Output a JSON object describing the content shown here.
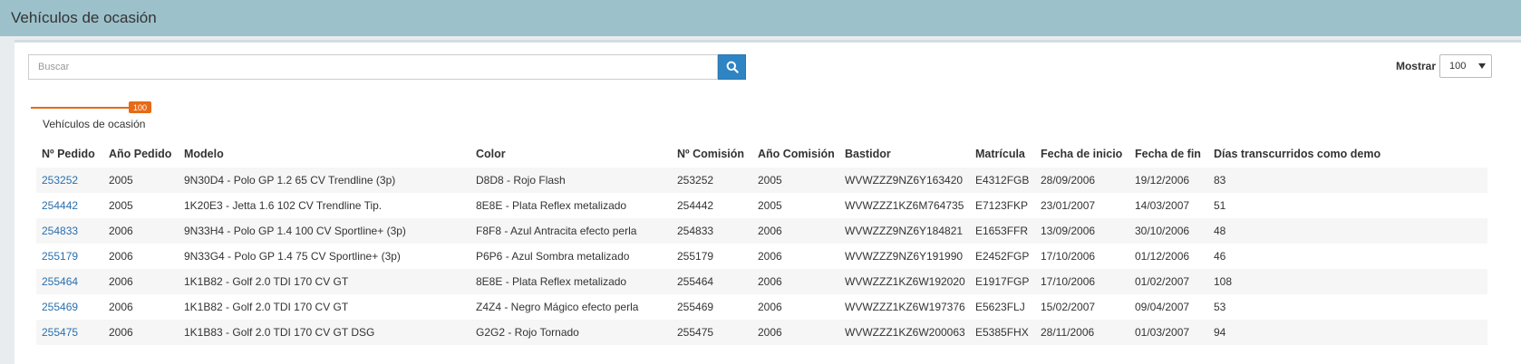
{
  "header": {
    "title": "Vehículos de ocasión"
  },
  "search": {
    "placeholder": "Buscar"
  },
  "show": {
    "label": "Mostrar",
    "value": "100"
  },
  "tab": {
    "label": "Vehículos de ocasión",
    "count": "100"
  },
  "table": {
    "columns": [
      "Nº Pedido",
      "Año Pedido",
      "Modelo",
      "Color",
      "Nº Comisión",
      "Año Comisión",
      "Bastidor",
      "Matrícula",
      "Fecha de inicio",
      "Fecha de fin",
      "Días transcurridos como demo"
    ],
    "rows": [
      [
        "253252",
        "2005",
        "9N30D4 - Polo GP 1.2 65 CV Trendline (3p)",
        "D8D8 - Rojo Flash",
        "253252",
        "2005",
        "WVWZZZ9NZ6Y163420",
        "E4312FGB",
        "28/09/2006",
        "19/12/2006",
        "83"
      ],
      [
        "254442",
        "2005",
        "1K20E3 - Jetta 1.6 102 CV Trendline Tip.",
        "8E8E - Plata Reflex metalizado",
        "254442",
        "2005",
        "WVWZZZ1KZ6M764735",
        "E7123FKP",
        "23/01/2007",
        "14/03/2007",
        "51"
      ],
      [
        "254833",
        "2006",
        "9N33H4 - Polo GP 1.4 100 CV Sportline+ (3p)",
        "F8F8 - Azul Antracita efecto perla",
        "254833",
        "2006",
        "WVWZZZ9NZ6Y184821",
        "E1653FFR",
        "13/09/2006",
        "30/10/2006",
        "48"
      ],
      [
        "255179",
        "2006",
        "9N33G4 - Polo GP 1.4 75 CV Sportline+ (3p)",
        "P6P6 - Azul Sombra metalizado",
        "255179",
        "2006",
        "WVWZZZ9NZ6Y191990",
        "E2452FGP",
        "17/10/2006",
        "01/12/2006",
        "46"
      ],
      [
        "255464",
        "2006",
        "1K1B82 - Golf 2.0 TDI 170 CV GT",
        "8E8E - Plata Reflex metalizado",
        "255464",
        "2006",
        "WVWZZZ1KZ6W192020",
        "E1917FGP",
        "17/10/2006",
        "01/02/2007",
        "108"
      ],
      [
        "255469",
        "2006",
        "1K1B82 - Golf 2.0 TDI 170 CV GT",
        "Z4Z4 - Negro Mágico efecto perla",
        "255469",
        "2006",
        "WVWZZZ1KZ6W197376",
        "E5623FLJ",
        "15/02/2007",
        "09/04/2007",
        "53"
      ],
      [
        "255475",
        "2006",
        "1K1B83 - Golf 2.0 TDI 170 CV GT DSG",
        "G2G2 - Rojo Tornado",
        "255475",
        "2006",
        "WVWZZZ1KZ6W200063",
        "E5385FHX",
        "28/11/2006",
        "01/03/2007",
        "94"
      ]
    ]
  },
  "colors": {
    "header_bg": "#9cc1cb",
    "accent": "#e66a17",
    "button": "#2f84c4",
    "link": "#2a6fad"
  },
  "icons": {
    "search": "search-icon",
    "dropdown": "caret-down-icon"
  }
}
